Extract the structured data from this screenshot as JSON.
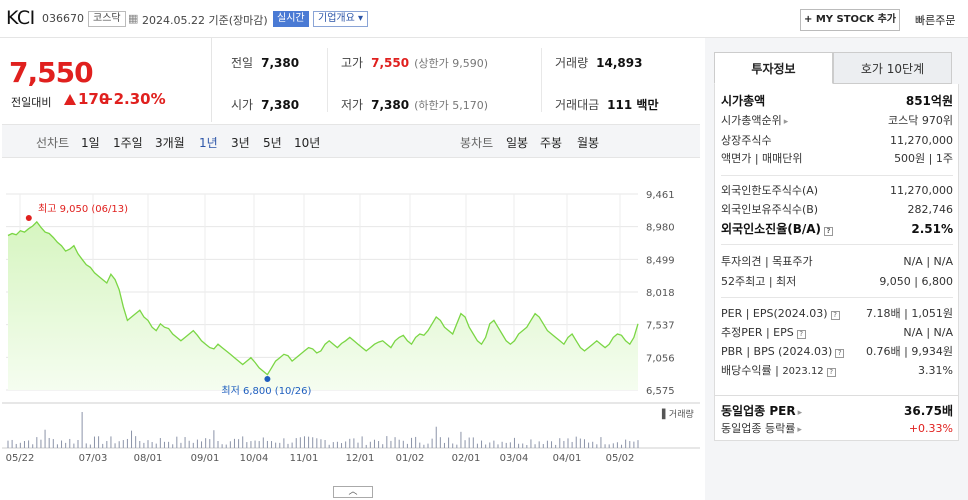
{
  "header": {
    "name": "KCI",
    "code": "036670",
    "market": "코스닥",
    "date": "2024.05.22 기준(장마감)",
    "realtime": "실시간",
    "company_info": "기업개요",
    "mystock": "+ MY STOCK 추가",
    "quick_order": "빠른주문"
  },
  "price": {
    "current": "7,550",
    "change_label": "전일대비",
    "change": "170",
    "change_pct": "+2.30%",
    "color_up": "#e0201e"
  },
  "stats": {
    "prev_label": "전일",
    "prev": "7,380",
    "high_label": "고가",
    "high": "7,550",
    "upper_limit": "(상한가 9,590)",
    "volume_label": "거래량",
    "volume": "14,893",
    "open_label": "시가",
    "open": "7,380",
    "low_label": "저가",
    "low": "7,380",
    "lower_limit": "(하한가 5,170)",
    "amount_label": "거래대금",
    "amount": "111 백만"
  },
  "chart_tabs": {
    "line_label": "선차트",
    "line_ranges": [
      "1일",
      "1주일",
      "3개월",
      "1년",
      "3년",
      "5년",
      "10년"
    ],
    "active": "1년",
    "candle_label": "봉차트",
    "candle_ranges": [
      "일봉",
      "주봉",
      "월봉"
    ]
  },
  "right": {
    "tab_on": "투자정보",
    "tab_off": "호가 10단계",
    "rows": {
      "mcap_k": "시가총액",
      "mcap_v": "851억원",
      "rank_k": "시가총액순위",
      "rank_v": "코스닥 970위",
      "shares_k": "상장주식수",
      "shares_v": "11,270,000",
      "face_k": "액면가 | 매매단위",
      "face_v": "500원 | 1주",
      "f_limit_k": "외국인한도주식수(A)",
      "f_limit_v": "11,270,000",
      "f_hold_k": "외국인보유주식수(B)",
      "f_hold_v": "282,746",
      "f_ratio_k": "외국인소진율(B/A)",
      "f_ratio_v": "2.51%",
      "opinion_k": "투자의견 | 목표주가",
      "opinion_v": "N/A | N/A",
      "w52_k": "52주최고 | 최저",
      "w52_v": "9,050 | 6,800",
      "per_k": "PER | EPS(2024.03)",
      "per_v1": "7.18배",
      "per_v2": "1,051원",
      "eper_k": "추정PER | EPS",
      "eper_v": "N/A | N/A",
      "pbr_k": "PBR | BPS (2024.03)",
      "pbr_v1": "0.76배",
      "pbr_v2": "9,934원",
      "div_k": "배당수익률",
      "div_date": "2023.12",
      "div_v": "3.31%",
      "ind_per_k": "동일업종 PER",
      "ind_per_v": "36.75배",
      "ind_chg_k": "동일업종 등락률",
      "ind_chg_v": "+0.33%"
    }
  },
  "chart_data": {
    "type": "area",
    "y_ticks": [
      "9,461",
      "8,980",
      "8,499",
      "8,018",
      "7,537",
      "7,056",
      "6,575"
    ],
    "y_tick_values": [
      9461,
      8980,
      8499,
      8018,
      7537,
      7056,
      6575
    ],
    "x_ticks": [
      "05/22",
      "07/03",
      "08/01",
      "09/01",
      "10/04",
      "11/01",
      "12/01",
      "01/02",
      "02/01",
      "03/04",
      "04/01",
      "05/02"
    ],
    "high_label": "최고 9,050 (06/13)",
    "low_label": "최저 6,800 (10/26)",
    "volume_label": "거래량",
    "line_color": "#7bd645",
    "fill_color": "#d6f5c0",
    "values": [
      8850,
      8880,
      8860,
      8920,
      8900,
      8950,
      8990,
      9050,
      8970,
      8900,
      8880,
      8820,
      8750,
      8700,
      8620,
      8650,
      8700,
      8580,
      8500,
      8420,
      8380,
      8300,
      8250,
      8200,
      8150,
      8280,
      8200,
      8050,
      7800,
      7600,
      7650,
      7700,
      7750,
      7650,
      7600,
      7500,
      7450,
      7550,
      7500,
      7480,
      7400,
      7350,
      7300,
      7350,
      7400,
      7450,
      7380,
      7300,
      7250,
      7200,
      7180,
      7250,
      7200,
      7150,
      7100,
      7050,
      7000,
      6950,
      7000,
      7050,
      6980,
      6900,
      6850,
      6800,
      6900,
      7000,
      7050,
      7100,
      7080,
      7000,
      7050,
      7100,
      7150,
      7200,
      7180,
      7120,
      7150,
      7250,
      7300,
      7250,
      7200,
      7260,
      7300,
      7350,
      7300,
      7250,
      7200,
      7150,
      7200,
      7250,
      7280,
      7300,
      7250,
      7200,
      7300,
      7350,
      7380,
      7300,
      7250,
      7350,
      7400,
      7380,
      7450,
      7550,
      7650,
      7600,
      7500,
      7450,
      7400,
      7550,
      7700,
      7650,
      7500,
      7400,
      7300,
      7250,
      7350,
      7550,
      7600,
      7500,
      7400,
      7300,
      7250,
      7300,
      7400,
      7450,
      7500,
      7600,
      7700,
      7650,
      7550,
      7450,
      7400,
      7350,
      7300,
      7250,
      7350,
      7400,
      7300,
      7200,
      7150,
      7200,
      7250,
      7300,
      7250,
      7200,
      7250,
      7350,
      7400,
      7380,
      7300,
      7250,
      7350,
      7550
    ]
  }
}
